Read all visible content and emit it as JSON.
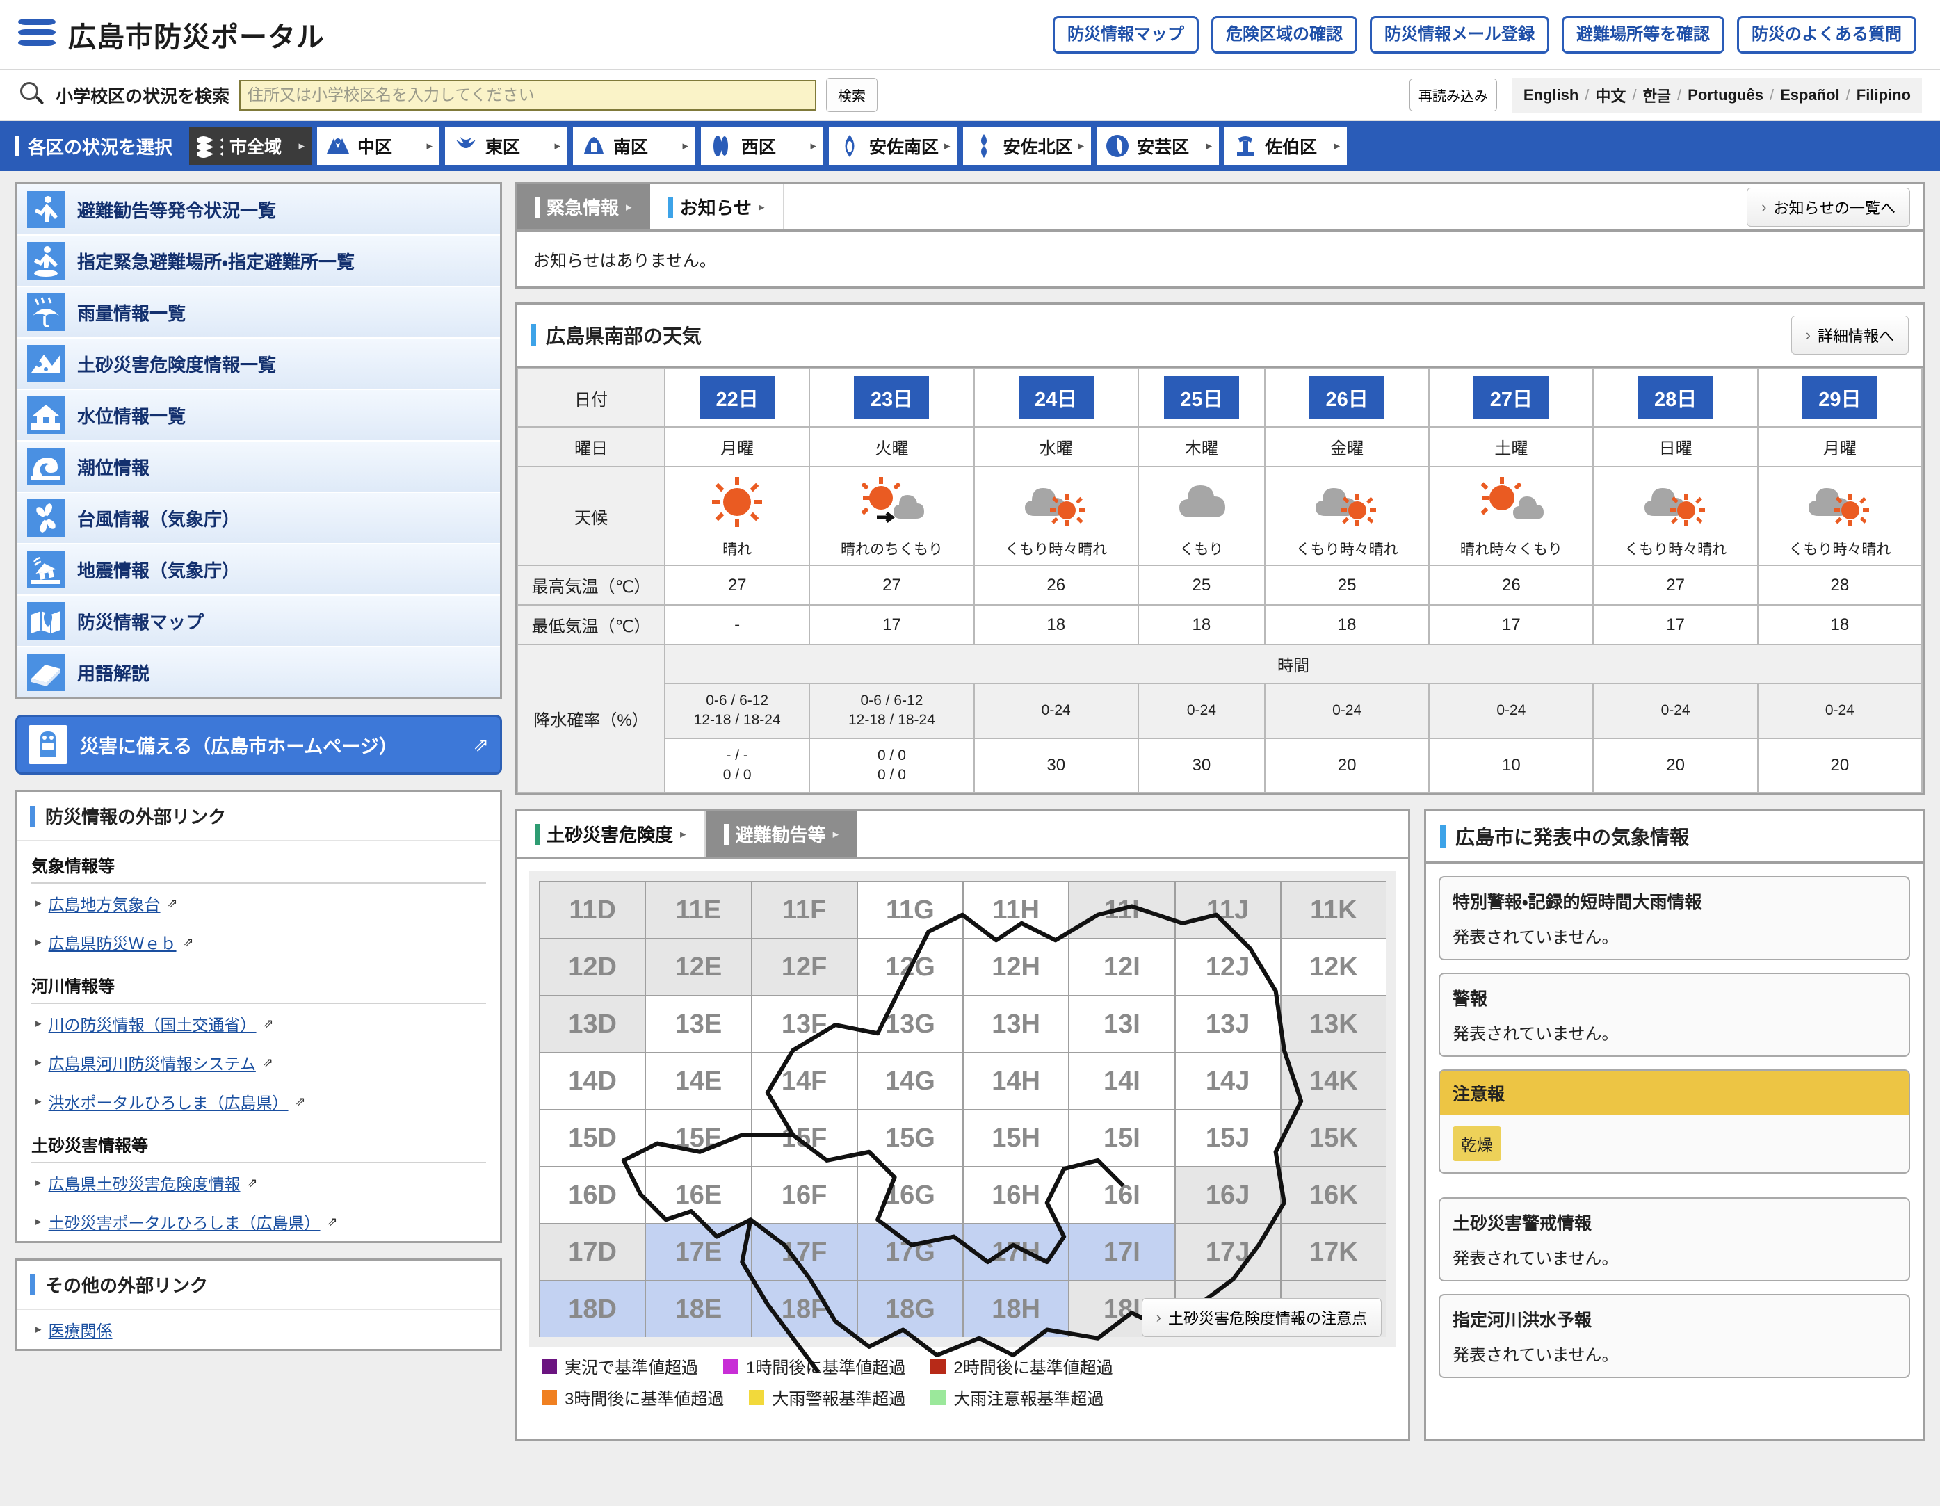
{
  "header": {
    "title": "広島市防災ポータル",
    "buttons": [
      "防災情報マップ",
      "危険区域の確認",
      "防災情報メール登録",
      "避難場所等を確認",
      "防災のよくある質問"
    ]
  },
  "search": {
    "label": "小学校区の状況を検索",
    "placeholder": "住所又は小学校区名を入力してください",
    "value": "",
    "submit": "検索",
    "reload": "再読み込み",
    "languages": [
      "English",
      "中文",
      "한글",
      "Português",
      "Español",
      "Filipino"
    ]
  },
  "wardnav": {
    "title": "各区の状況を選択",
    "wards": [
      {
        "label": "市全域",
        "active": true
      },
      {
        "label": "中区",
        "active": false
      },
      {
        "label": "東区",
        "active": false
      },
      {
        "label": "南区",
        "active": false
      },
      {
        "label": "西区",
        "active": false
      },
      {
        "label": "安佐南区",
        "active": false
      },
      {
        "label": "安佐北区",
        "active": false
      },
      {
        "label": "安芸区",
        "active": false
      },
      {
        "label": "佐伯区",
        "active": false
      }
    ]
  },
  "sidebar": {
    "menu": [
      {
        "label": "避難勧告等発令状況一覧",
        "icon": "evacuee-running-icon"
      },
      {
        "label": "指定緊急避難場所・指定避難所一覧",
        "icon": "evacuation-site-icon"
      },
      {
        "label": "雨量情報一覧",
        "icon": "umbrella-rain-icon"
      },
      {
        "label": "土砂災害危険度情報一覧",
        "icon": "landslide-icon"
      },
      {
        "label": "水位情報一覧",
        "icon": "flood-house-icon"
      },
      {
        "label": "潮位情報",
        "icon": "wave-icon"
      },
      {
        "label": "台風情報（気象庁）",
        "icon": "typhoon-icon"
      },
      {
        "label": "地震情報（気象庁）",
        "icon": "earthquake-house-icon"
      },
      {
        "label": "防災情報マップ",
        "icon": "map-pin-icon"
      },
      {
        "label": "用語解説",
        "icon": "book-icon"
      }
    ],
    "prepare_button": "災害に備える（広島市ホームページ）",
    "ext_links": {
      "title": "防災情報の外部リンク",
      "groups": [
        {
          "title": "気象情報等",
          "links": [
            "広島地方気象台",
            "広島県防災Ｗｅｂ"
          ]
        },
        {
          "title": "河川情報等",
          "links": [
            "川の防災情報（国土交通省）",
            "広島県河川防災情報システム",
            "洪水ポータルひろしま（広島県）"
          ]
        },
        {
          "title": "土砂災害情報等",
          "links": [
            "広島県土砂災害危険度情報",
            "土砂災害ポータルひろしま（広島県）"
          ]
        }
      ]
    },
    "other_links": {
      "title": "その他の外部リンク",
      "links": [
        "医療関係"
      ]
    }
  },
  "notices": {
    "tab_emergency": "緊急情報",
    "tab_news": "お知らせ",
    "list_button": "お知らせの一覧へ",
    "empty_text": "お知らせはありません。"
  },
  "weather": {
    "title": "広島県南部の天気",
    "detail_button": "詳細情報へ",
    "row_labels": {
      "date": "日付",
      "weekday": "曜日",
      "condition": "天候",
      "max_temp": "最高気温（℃）",
      "min_temp": "最低気温（℃）",
      "precip": "降水確率（%）",
      "time": "時間"
    }
  },
  "chart_data": {
    "type": "table",
    "title": "広島県南部の天気",
    "categories": [
      "22日",
      "23日",
      "24日",
      "25日",
      "26日",
      "27日",
      "28日",
      "29日"
    ],
    "weekdays": [
      "月曜",
      "火曜",
      "水曜",
      "木曜",
      "金曜",
      "土曜",
      "日曜",
      "月曜"
    ],
    "conditions": [
      "晴れ",
      "晴れのちくもり",
      "くもり時々晴れ",
      "くもり",
      "くもり時々晴れ",
      "晴れ時々くもり",
      "くもり時々晴れ",
      "くもり時々晴れ"
    ],
    "condition_icons": [
      "sun",
      "sun-then-cloud",
      "cloud-sun",
      "cloud",
      "cloud-sun",
      "sun-cloud",
      "cloud-sun",
      "cloud-sun"
    ],
    "max_temp": [
      "27",
      "27",
      "26",
      "25",
      "25",
      "26",
      "27",
      "28"
    ],
    "min_temp": [
      "-",
      "17",
      "18",
      "18",
      "18",
      "17",
      "17",
      "18"
    ],
    "precip_time_labels": [
      "0-6 / 6-12\n12-18 / 18-24",
      "0-6 / 6-12\n12-18 / 18-24",
      "0-24",
      "0-24",
      "0-24",
      "0-24",
      "0-24",
      "0-24"
    ],
    "precip_values": [
      "- / -\n0 / 0",
      "0 / 0\n0 / 0",
      "30",
      "30",
      "20",
      "10",
      "20",
      "20"
    ],
    "ylabel": "",
    "xlabel": ""
  },
  "sediment": {
    "tab_active": "土砂災害危険度",
    "tab_inactive": "避難勧告等",
    "note_button": "土砂災害危険度情報の注意点",
    "grid_rows": [
      "11",
      "12",
      "13",
      "14",
      "15",
      "16",
      "17",
      "18"
    ],
    "grid_cols": [
      "D",
      "E",
      "F",
      "G",
      "H",
      "I",
      "J",
      "K"
    ],
    "legend": [
      {
        "label": "実況で基準値超過",
        "color": "#6b1480"
      },
      {
        "label": "1時間後に基準値超過",
        "color": "#c82ed6"
      },
      {
        "label": "2時間後に基準値超過",
        "color": "#b72a18"
      },
      {
        "label": "3時間後に基準値超過",
        "color": "#f08021"
      },
      {
        "label": "大雨警報基準超過",
        "color": "#f2d93b"
      },
      {
        "label": "大雨注意報基準超過",
        "color": "#9be89b"
      }
    ]
  },
  "warnings": {
    "title": "広島市に発表中の気象情報",
    "cards": [
      {
        "title": "特別警報・記録的短時間大雨情報",
        "text": "発表されていません。",
        "alert": false,
        "chips": []
      },
      {
        "title": "警報",
        "text": "発表されていません。",
        "alert": false,
        "chips": []
      },
      {
        "title": "注意報",
        "text": "",
        "alert": true,
        "chips": [
          "乾燥"
        ]
      },
      {
        "title": "土砂災害警戒情報",
        "text": "発表されていません。",
        "alert": false,
        "chips": []
      },
      {
        "title": "指定河川洪水予報",
        "text": "発表されていません。",
        "alert": false,
        "chips": []
      }
    ]
  }
}
